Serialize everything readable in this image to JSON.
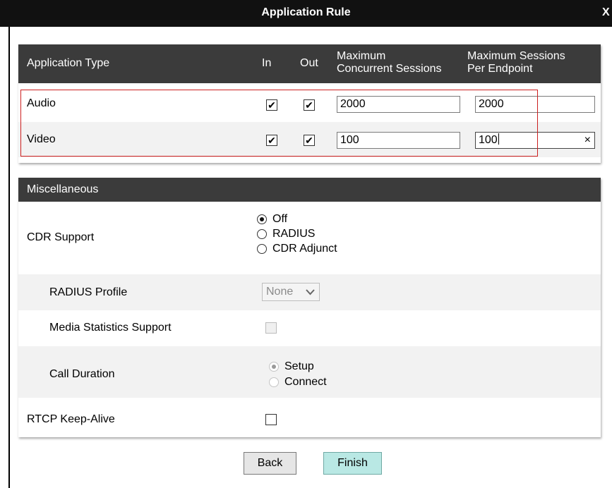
{
  "dialog": {
    "title": "Application Rule",
    "close_label": "X"
  },
  "app_table": {
    "headers": {
      "type": "Application Type",
      "in": "In",
      "out": "Out",
      "max_concurrent_line1": "Maximum",
      "max_concurrent_line2": "Concurrent Sessions",
      "max_endpoint_line1": "Maximum Sessions",
      "max_endpoint_line2": "Per Endpoint"
    },
    "rows": [
      {
        "type": "Audio",
        "in_checked": true,
        "out_checked": true,
        "max_concurrent": "2000",
        "max_per_endpoint": "2000"
      },
      {
        "type": "Video",
        "in_checked": true,
        "out_checked": true,
        "max_concurrent": "100",
        "max_per_endpoint": "100"
      }
    ],
    "check_glyph": "✔",
    "clear_glyph": "×",
    "highlight_color": "#cc1f1f"
  },
  "misc": {
    "header": "Miscellaneous",
    "cdr_support": {
      "label": "CDR Support",
      "options": [
        "Off",
        "RADIUS",
        "CDR Adjunct"
      ],
      "selected": "Off"
    },
    "radius_profile": {
      "label": "RADIUS Profile",
      "value": "None",
      "chevron": "⌄"
    },
    "media_stats": {
      "label": "Media Statistics Support",
      "checked": false
    },
    "call_duration": {
      "label": "Call Duration",
      "options": [
        "Setup",
        "Connect"
      ],
      "selected": "Setup"
    },
    "rtcp_keepalive": {
      "label": "RTCP Keep-Alive",
      "checked": false
    }
  },
  "footer": {
    "back_label": "Back",
    "finish_label": "Finish",
    "finish_color": "#b9e8e4",
    "back_color": "#e6e6e6"
  }
}
